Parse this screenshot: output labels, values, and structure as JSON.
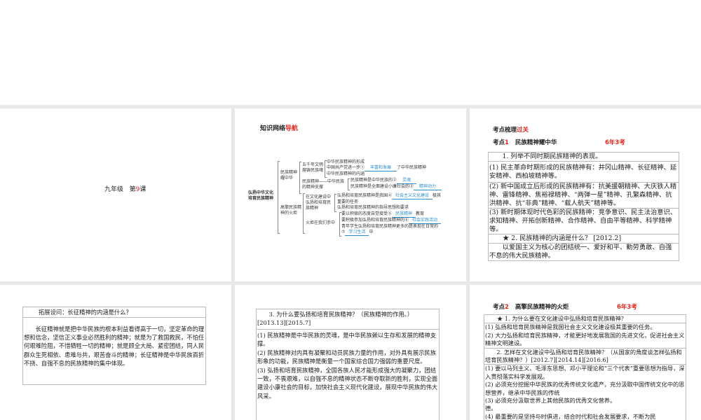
{
  "slide1": {
    "grade": "九年级",
    "lesson_prefix": "第",
    "lesson_num": "9",
    "lesson_suffix": "课"
  },
  "slide2": {
    "title_a": "知识网络",
    "title_b": "导航",
    "root": [
      "弘扬中华文化",
      "培育民族精神"
    ],
    "branch1": [
      "民族精神",
      "耀中华"
    ],
    "branch2": [
      "高擎民族精",
      "神的火炬"
    ],
    "b1a": [
      "五千年文明",
      "熔铸民族魂"
    ],
    "b1b": [
      "民族精神——中华民族",
      "的精神支撑"
    ],
    "b1a_items": [
      "中华民族精神的形成",
      "中国共产党进一步①",
      "了中华民族精神",
      "中华民族精神的内涵"
    ],
    "b1b_items": [
      "民族精神是中华民族的②",
      "民族精神是全面建设小康社会的③"
    ],
    "b2a": [
      "在文化建设中",
      "弘扬和培育民",
      "族精神"
    ],
    "b2a_items": [
      "弘扬和培育民族精神是我国④",
      "极其",
      "重要的任务",
      "弘扬和培育民族精神的指导思想和要求"
    ],
    "b2b": "火炬在我们手中",
    "b2b_items": [
      "要以积极的态度自觉接受⑤",
      "教育",
      "要积极参加弘扬和培育民族精神的⑥",
      "青年学生弘扬和培育民族精神更多的是表现在日常的",
      "⑦",
      "中"
    ],
    "answers": [
      "丰富和发展",
      "灵魂",
      "精神动力",
      "社会主义文化建设",
      "民族精神",
      "社会实践活动",
      "学习生活"
    ]
  },
  "slide3": {
    "title_a": "考点梳理",
    "title_b": "过关",
    "kp_a": "考点",
    "kp_num": "1",
    "kp_title": "民族精神耀中华",
    "freq": "6年3考",
    "rows": [
      "1. 列举不同时期民族精神的表现。",
      "(1) 民主革命时期形成的民族精神有：井冈山精神、长征精神、延安精神、西柏坡精神等。",
      "(2) 新中国成立后形成的民族精神有：抗美援朝精神、大庆铁人精神、雷锋精神、焦裕禄精神、“两弹一星”精神、孔繁森精神、抗洪精神、抗“非典”精神、“载人航天”精神等。",
      "(3) 新时期体现时代色彩的民族精神：竞争意识、民主法治意识、求知精神、开拓创新精神、合作精神、自由平等精神、科学精神等。",
      "★ 2. 民族精神的内涵是什么？ [2012.2]",
      "以爱国主义为核心的团结统一、爱好和平、勤劳勇敢、自强不息的伟大民族精神。"
    ]
  },
  "slide4": {
    "question": "拓展设问：长征精神的内涵是什么？",
    "answer": "长征精神就是把中华民族的根本利益看得高于一切，坚定革命的理想和信念，坚信正义事业必然胜利的精神；就是为了救国救民，不怕任何艰难险阻，不惜牺牲一切的精神；就是顾全大局、紧密团结，同人民群众生死相依、患难与共，艰苦奋斗的精神；长征精神是中华民族百折不挠、自强不息的民族精神的集中体现。"
  },
  "slide5": {
    "question": "3. 为什么要弘扬和培育民族精神？（民族精神的作用。）[2013.13][2015.7]",
    "answers": [
      "(1) 民族精神是中华民族的灵魂，是中华民族赖以生存和发展的精神支撑。",
      "(2) 民族精神对内具有凝聚和动员民族力量的作用，对外具有展示民族形象的功能，民族精神是衡量一个国家综合国力强弱的重要尺度。",
      "(3) 弘扬和培育民族精神，全国各族人民才能形成强大的凝聚力，团结一致，不畏艰难，以自强不息的精神状态不断夺取新的胜利，实现全面建设小康社会的目标，加快社会主义现代化建设，展现中华民族的伟大风采。"
    ]
  },
  "slide6": {
    "kp_a": "考点",
    "kp_num": "2",
    "kp_title": "高擎民族精神的火炬",
    "freq": "6年3考",
    "q1": "★ 1. 为什么要在文化建设中弘扬和培育民族精神？",
    "a1": [
      "(1) 弘扬和培育民族精神是我国社会主义文化建设极其重要的任务。",
      "(2) 大力弘扬和培育民族精神，才能更好地发展我国的先进文化，促进社会主义精神文明建设。"
    ],
    "q2": "2. 怎样在文化建设中弘扬和培育民族精神？（从国家的角度谈怎样弘扬和培育民族精神？）[2012.7][2014.14][2016.6]",
    "a2": [
      "(1) 要以马列主义、毛泽东思想、邓小平理论和“三个代表”重要思想为指导，深入贯彻落实科学发展观。",
      "(2) 必须充分挖掘中华民族的优秀传统文化遗产，充分汲取中国传统文化中的思想营养，继承中华民族的传统",
      "(3) 必须充分汲取世界上其他民族的优秀文化营养。",
      "德。",
      "(4) 最重要的是坚持与时俱进，结合时代和社会发展要求，不断为民"
    ]
  }
}
